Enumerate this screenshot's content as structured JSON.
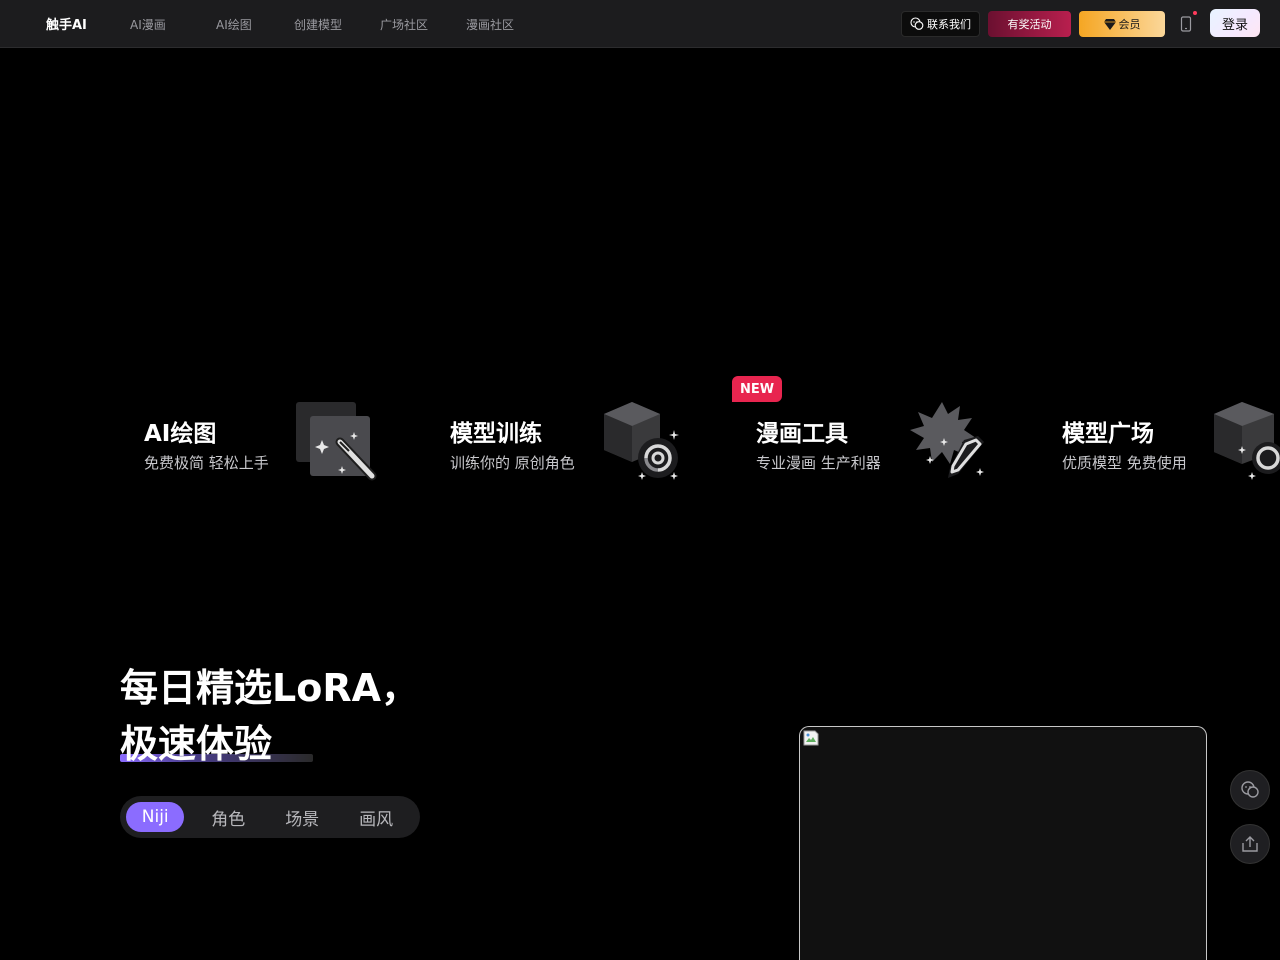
{
  "header": {
    "brand": "触手AI",
    "nav": [
      "AI漫画",
      "AI绘图",
      "创建模型",
      "广场社区",
      "漫画社区"
    ],
    "contact_label": "联系我们",
    "activity_label": "有奖活动",
    "vip_label": "会员",
    "login_label": "登录"
  },
  "features": [
    {
      "title": "AI绘图",
      "subtitle": "免费极简 轻松上手"
    },
    {
      "title": "模型训练",
      "subtitle": "训练你的 原创角色"
    },
    {
      "title": "漫画工具",
      "subtitle": "专业漫画 生产利器",
      "badge": "NEW"
    },
    {
      "title": "模型广场",
      "subtitle": "优质模型 免费使用"
    }
  ],
  "hero": {
    "line1": "每日精选LoRA，",
    "line2": "极速体验",
    "tabs": [
      "Niji",
      "角色",
      "场景",
      "画风"
    ],
    "active_tab": "Niji"
  },
  "colors": {
    "accent": "#8b6cff",
    "badge_red": "#e8254f",
    "vip_gold": "#f5a623"
  }
}
